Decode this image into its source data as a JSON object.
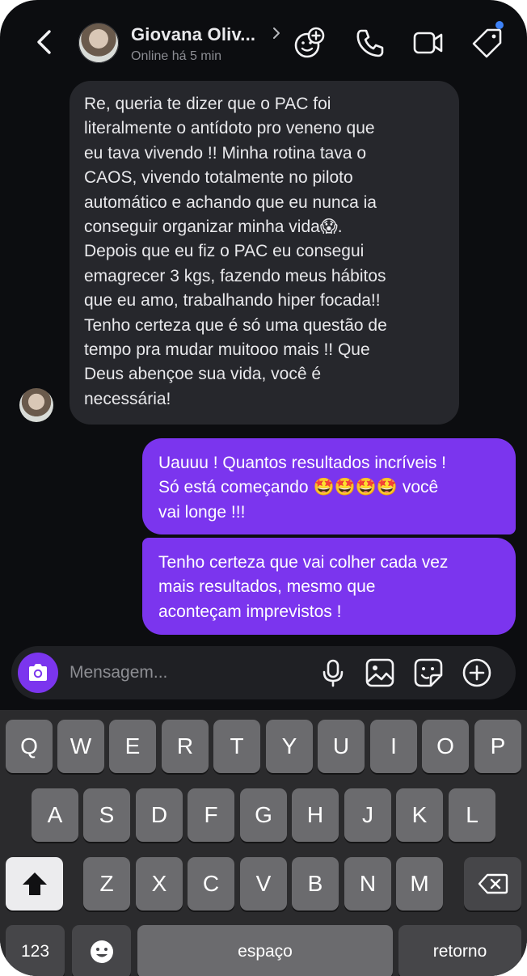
{
  "header": {
    "contact_name": "Giovana Oliv...",
    "status": "Online há 5 min",
    "icons": [
      "back-icon",
      "chevron-right-icon",
      "effects-icon",
      "phone-icon",
      "video-icon",
      "tag-icon"
    ]
  },
  "messages": {
    "incoming_1": "Re, queria te dizer que o PAC foi\nliteralmente o antídoto pro veneno que\neu tava vivendo !! Minha rotina tava o\nCAOS, vivendo totalmente no piloto\nautomático e achando que eu nunca ia\nconseguir organizar minha vida😱.\nDepois que eu fiz o PAC eu consegui\nemagrecer 3 kgs, fazendo meus hábitos\nque eu amo, trabalhando hiper focada!!\nTenho certeza que é só uma questão de\ntempo pra mudar muitooo mais !! Que\nDeus abençoe sua vida, você é\nnecessária!",
    "outgoing_1": "Uauuu ! Quantos resultados incríveis !\nSó está começando 🤩🤩🤩🤩 você\nvai longe !!!",
    "outgoing_2": "Tenho certeza que vai colher cada vez\nmais resultados, mesmo que\naconteçam imprevistos !"
  },
  "composer": {
    "placeholder": "Mensagem...",
    "icons": [
      "camera-icon",
      "microphone-icon",
      "gallery-icon",
      "sticker-icon",
      "plus-icon"
    ]
  },
  "keyboard": {
    "row1": [
      "Q",
      "W",
      "E",
      "R",
      "T",
      "Y",
      "U",
      "I",
      "O",
      "P"
    ],
    "row2": [
      "A",
      "S",
      "D",
      "F",
      "G",
      "H",
      "J",
      "K",
      "L"
    ],
    "row3": [
      "Z",
      "X",
      "C",
      "V",
      "B",
      "N",
      "M"
    ],
    "numbers_key": "123",
    "space_key": "espaço",
    "return_key": "retorno"
  },
  "colors": {
    "background": "#0c0d10",
    "incoming_bubble": "#26272c",
    "outgoing_bubble": "#7b35ee",
    "notification_dot": "#3e82f7",
    "keyboard_bg": "#2b2b2d"
  }
}
